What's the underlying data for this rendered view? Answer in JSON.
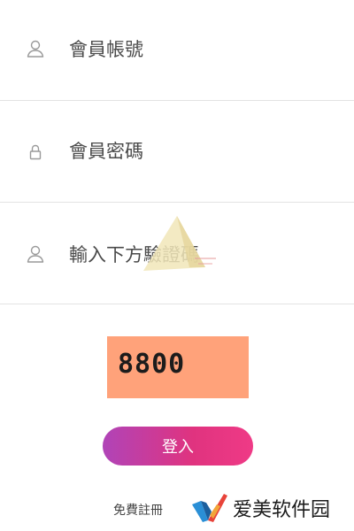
{
  "form": {
    "username_placeholder": "會員帳號",
    "password_placeholder": "會員密碼",
    "captcha_placeholder": "輸入下方驗證碼"
  },
  "captcha": {
    "code": "8800",
    "background_color": "#ffa27a"
  },
  "actions": {
    "login_label": "登入",
    "register_label": "免費註冊"
  },
  "watermark": {
    "text": "爱美软件园"
  },
  "icons": {
    "username": "user-icon",
    "password": "lock-icon",
    "captcha": "user-icon"
  },
  "colors": {
    "button_gradient_start": "#b044b8",
    "button_gradient_end": "#ef3a86",
    "divider": "#e3e3e3"
  }
}
